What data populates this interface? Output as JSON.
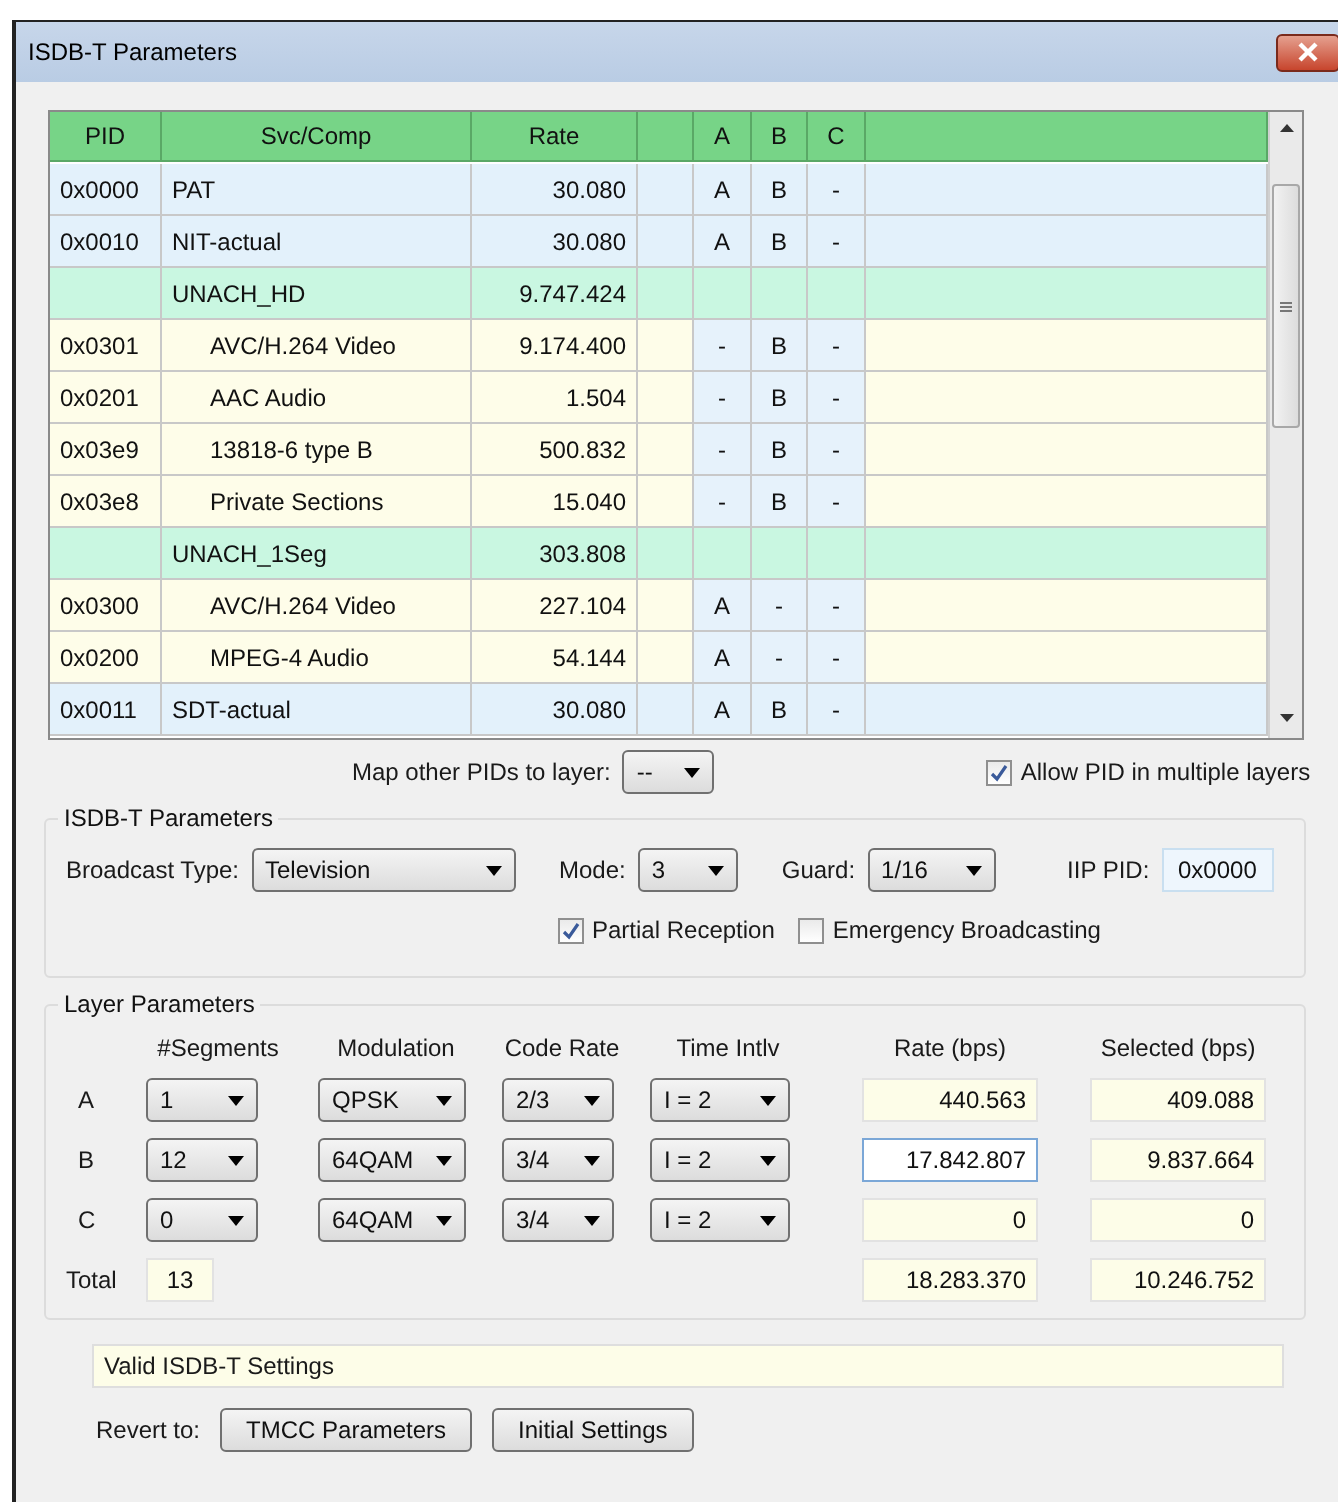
{
  "window": {
    "title": "ISDB-T Parameters"
  },
  "table": {
    "columns": [
      "PID",
      "Svc/Comp",
      "Rate",
      "A",
      "B",
      "C"
    ],
    "rows": [
      {
        "kind": "stream",
        "pid": "0x0000",
        "name": "PAT",
        "rate": "30.080",
        "layers": [
          "A",
          "B",
          "-"
        ]
      },
      {
        "kind": "stream",
        "pid": "0x0010",
        "name": "NIT-actual",
        "rate": "30.080",
        "layers": [
          "A",
          "B",
          "-"
        ]
      },
      {
        "kind": "service",
        "name": "UNACH_HD",
        "rate": "9.747.424"
      },
      {
        "kind": "component",
        "pid": "0x0301",
        "name": "AVC/H.264 Video",
        "rate": "9.174.400",
        "layers": [
          "-",
          "B",
          "-"
        ]
      },
      {
        "kind": "component",
        "pid": "0x0201",
        "name": "AAC Audio",
        "rate": "1.504",
        "layers": [
          "-",
          "B",
          "-"
        ]
      },
      {
        "kind": "component",
        "pid": "0x03e9",
        "name": "13818-6 type B",
        "rate": "500.832",
        "layers": [
          "-",
          "B",
          "-"
        ]
      },
      {
        "kind": "component",
        "pid": "0x03e8",
        "name": "Private Sections",
        "rate": "15.040",
        "layers": [
          "-",
          "B",
          "-"
        ]
      },
      {
        "kind": "service",
        "name": "UNACH_1Seg",
        "rate": "303.808"
      },
      {
        "kind": "component",
        "pid": "0x0300",
        "name": "AVC/H.264 Video",
        "rate": "227.104",
        "layers": [
          "A",
          "-",
          "-"
        ]
      },
      {
        "kind": "component",
        "pid": "0x0200",
        "name": "MPEG-4 Audio",
        "rate": "54.144",
        "layers": [
          "A",
          "-",
          "-"
        ]
      },
      {
        "kind": "stream",
        "pid": "0x0011",
        "name": "SDT-actual",
        "rate": "30.080",
        "layers": [
          "A",
          "B",
          "-"
        ]
      }
    ]
  },
  "map_layer": {
    "label": "Map other PIDs to layer:",
    "value": "--"
  },
  "allow_multiple": {
    "label": "Allow PID in multiple layers",
    "checked": true
  },
  "isdbt_group": {
    "title": "ISDB-T Parameters",
    "broadcast_type": {
      "label": "Broadcast Type:",
      "value": "Television"
    },
    "mode": {
      "label": "Mode:",
      "value": "3"
    },
    "guard": {
      "label": "Guard:",
      "value": "1/16"
    },
    "iip_pid": {
      "label": "IIP PID:",
      "value": "0x0000"
    },
    "checks": [
      {
        "label": "Partial Reception",
        "checked": true
      },
      {
        "label": "Emergency Broadcasting",
        "checked": false
      }
    ]
  },
  "layer_group": {
    "title": "Layer Parameters",
    "columns": [
      "#Segments",
      "Modulation",
      "Code Rate",
      "Time Intlv",
      "Rate (bps)",
      "Selected (bps)"
    ],
    "rows": [
      {
        "label": "A",
        "segments": "1",
        "modulation": "QPSK",
        "code_rate": "2/3",
        "time_intlv": "I = 2",
        "rate": "440.563",
        "selected": "409.088",
        "focused": false
      },
      {
        "label": "B",
        "segments": "12",
        "modulation": "64QAM",
        "code_rate": "3/4",
        "time_intlv": "I = 2",
        "rate": "17.842.807",
        "selected": "9.837.664",
        "focused": true
      },
      {
        "label": "C",
        "segments": "0",
        "modulation": "64QAM",
        "code_rate": "3/4",
        "time_intlv": "I = 2",
        "rate": "0",
        "selected": "0",
        "focused": false
      }
    ],
    "total": {
      "label": "Total",
      "segments": "13",
      "rate": "18.283.370",
      "selected": "10.246.752"
    }
  },
  "status": "Valid ISDB-T Settings",
  "revert": {
    "label": "Revert to:",
    "buttons": [
      "TMCC Parameters",
      "Initial Settings"
    ]
  }
}
